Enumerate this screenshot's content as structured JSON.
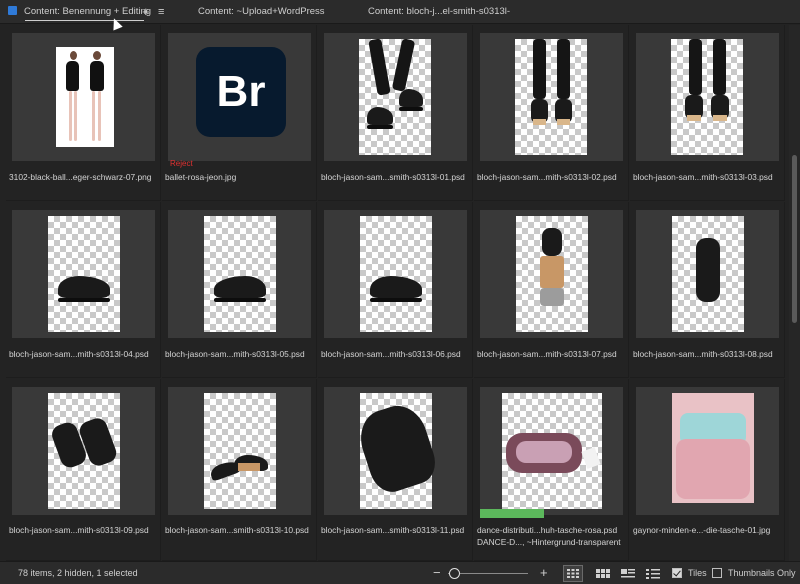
{
  "tabs": [
    {
      "label": "Content: Benennung + Editing",
      "active": true
    },
    {
      "label": "Content: ~Upload+WordPress",
      "active": false
    },
    {
      "label": "Content: bloch-j...el-smith-s0313l-",
      "active": false
    }
  ],
  "tab_add_icon": "+",
  "tab_menu_icon": "≡",
  "items": [
    {
      "filename": "3102-black-ball...eger-schwarz-07.png",
      "kind": "dancers-photo"
    },
    {
      "filename": "ballet-rosa-jeon.jpg",
      "kind": "bridge-logo",
      "flag": "Reject",
      "logo_text": "Br"
    },
    {
      "filename": "bloch-jason-sam...smith-s0313l-01.psd",
      "kind": "legs-shoes"
    },
    {
      "filename": "bloch-jason-sam...mith-s0313l-02.psd",
      "kind": "legs-back"
    },
    {
      "filename": "bloch-jason-sam...mith-s0313l-03.psd",
      "kind": "legs-back"
    },
    {
      "filename": "bloch-jason-sam...mith-s0313l-04.psd",
      "kind": "shoe"
    },
    {
      "filename": "bloch-jason-sam...mith-s0313l-05.psd",
      "kind": "shoe"
    },
    {
      "filename": "bloch-jason-sam...mith-s0313l-06.psd",
      "kind": "shoe"
    },
    {
      "filename": "bloch-jason-sam...mith-s0313l-07.psd",
      "kind": "shoe-sole"
    },
    {
      "filename": "bloch-jason-sam...mith-s0313l-08.psd",
      "kind": "shoe-top"
    },
    {
      "filename": "bloch-jason-sam...mith-s0313l-09.psd",
      "kind": "shoe-pair"
    },
    {
      "filename": "bloch-jason-sam...smith-s0313l-10.psd",
      "kind": "shoe-pair"
    },
    {
      "filename": "bloch-jason-sam...smith-s0313l-11.psd",
      "kind": "shoe-large"
    },
    {
      "filename": "dance-distributi...huh-tasche-rosa.psd",
      "kind": "bag",
      "label_color": "#5cb85c",
      "filename_line2": "DANCE-D..., ~Hintergrund-transparent"
    },
    {
      "filename": "gaynor-minden-e...-die-tasche-01.jpg",
      "kind": "pink-bag"
    }
  ],
  "status": {
    "text": "78 items, 2 hidden, 1 selected"
  },
  "zoom": {
    "minus": "−",
    "plus": "+",
    "level": 0.05
  },
  "view_buttons": [
    {
      "name": "grid-view-icon",
      "active": true
    },
    {
      "name": "details-view-icon",
      "active": false
    },
    {
      "name": "list-view-icon",
      "active": false
    },
    {
      "name": "compact-list-icon",
      "active": false
    }
  ],
  "options": {
    "tiles_label": "Tiles",
    "tiles_checked": true,
    "thumbnails_only_label": "Thumbnails Only",
    "thumbnails_only_checked": false
  }
}
